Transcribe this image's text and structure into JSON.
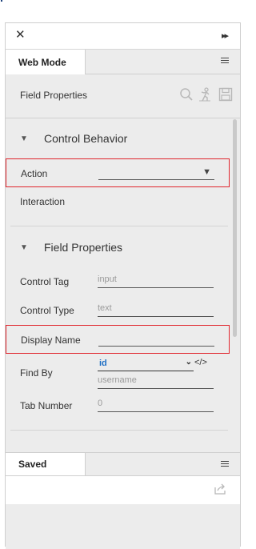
{
  "window": {
    "close_glyph": "✕",
    "dock_glyph": "▸▸"
  },
  "tabs": {
    "active": "Web Mode"
  },
  "toolbar": {
    "title": "Field Properties"
  },
  "control_behavior": {
    "header": "Control Behavior",
    "action": {
      "label": "Action",
      "value": ""
    },
    "interaction": {
      "label": "Interaction"
    }
  },
  "field_properties": {
    "header": "Field Properties",
    "control_tag": {
      "label": "Control Tag",
      "value": "input"
    },
    "control_type": {
      "label": "Control Type",
      "value": "text"
    },
    "display_name": {
      "label": "Display Name",
      "value": ""
    },
    "find_by": {
      "label": "Find By",
      "selected": "id",
      "value": "username"
    },
    "tab_number": {
      "label": "Tab Number",
      "value": "0"
    }
  },
  "saved": {
    "tab": "Saved"
  },
  "colors": {
    "highlight": "#e0252d",
    "link": "#1f6fc5",
    "panel_bg": "#ececec"
  }
}
